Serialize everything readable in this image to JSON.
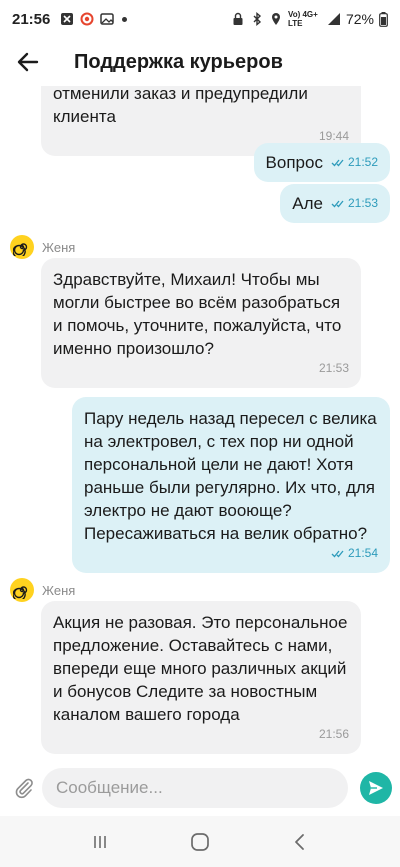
{
  "status_bar": {
    "time": "21:56",
    "network_text": "Vo) 4G+ LTE",
    "battery": "72%"
  },
  "header": {
    "title": "Поддержка курьеров"
  },
  "messages": [
    {
      "id": "m0",
      "direction": "in",
      "text": "отменили заказ и предупредили клиента",
      "time": "19:44"
    },
    {
      "id": "m1",
      "direction": "out",
      "text": "Вопрос",
      "time": "21:52"
    },
    {
      "id": "m2",
      "direction": "out",
      "text": "Але",
      "time": "21:53"
    },
    {
      "id": "m3",
      "direction": "in",
      "sender": "Женя",
      "text": "Здравствуйте, Михаил! Чтобы мы могли быстрее во всём разобраться и помочь, уточните, пожалуйста, что именно произошло?",
      "time": "21:53"
    },
    {
      "id": "m4",
      "direction": "out",
      "text": "Пару недель назад пересел с велика на электровел, с тех пор ни одной персональной цели не дают! Хотя раньше были регулярно. Их что, для электро не дают вооюще? Пересаживаться на велик обратно?",
      "time": "21:54"
    },
    {
      "id": "m5",
      "direction": "in",
      "sender": "Женя",
      "text": "Акция не разовая. Это персональное предложение. Оставайтесь с нами, впереди еще много различных акций и бонусов Следите за новостным каналом вашего города",
      "time": "21:56"
    }
  ],
  "composer": {
    "placeholder": "Сообщение..."
  },
  "colors": {
    "incoming_bubble": "#f1f1f2",
    "outgoing_bubble": "#dcf1f6",
    "send_button": "#1fb6a6",
    "avatar": "#ffd21f",
    "read_ticks": "#2d9bbb"
  }
}
